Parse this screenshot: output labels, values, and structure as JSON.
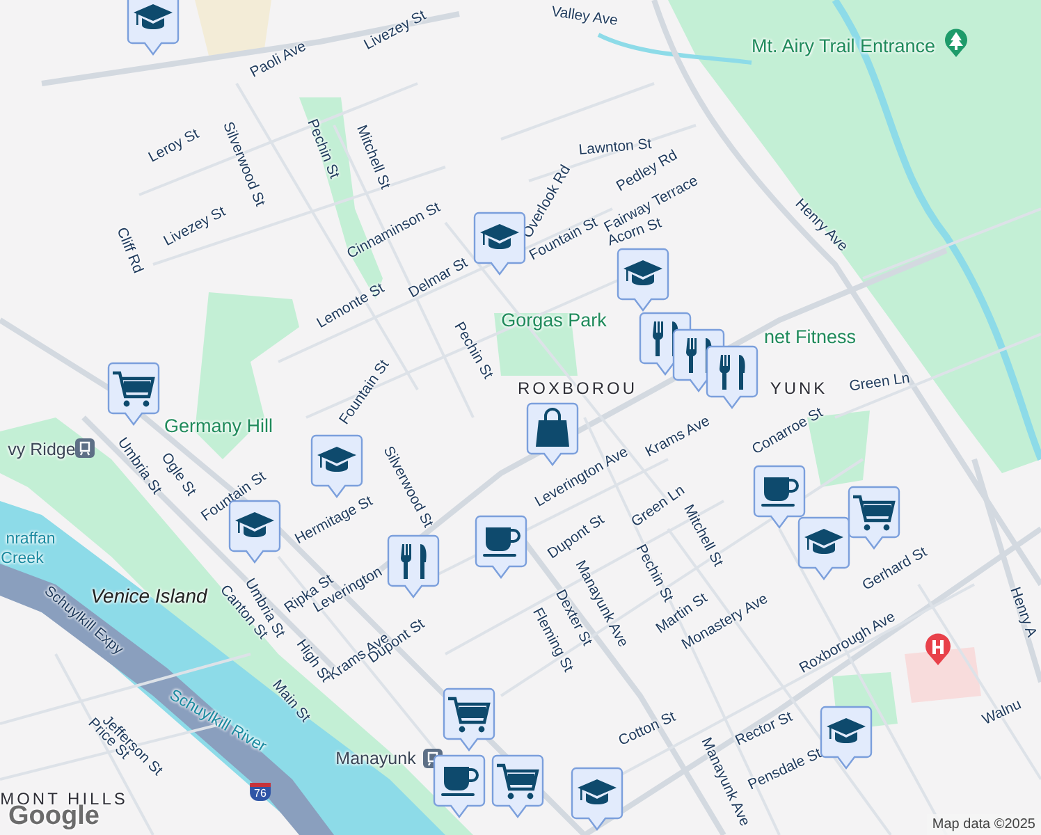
{
  "map": {
    "labels": [
      {
        "text": "Valley Ave",
        "kind": "street"
      },
      {
        "text": "Mt. Airy Trail Entrance",
        "kind": "park"
      },
      {
        "text": "Paoli Ave",
        "kind": "street"
      },
      {
        "text": "Livezey St",
        "kind": "street"
      },
      {
        "text": "Leroy St",
        "kind": "street"
      },
      {
        "text": "Silverwood St",
        "kind": "street"
      },
      {
        "text": "Pechin St",
        "kind": "street"
      },
      {
        "text": "Mitchell St",
        "kind": "street"
      },
      {
        "text": "Livezey St",
        "kind": "street"
      },
      {
        "text": "Cliff Rd",
        "kind": "street"
      },
      {
        "text": "Cinnaminson St",
        "kind": "street"
      },
      {
        "text": "Lemonte St",
        "kind": "street"
      },
      {
        "text": "Delmar St",
        "kind": "street"
      },
      {
        "text": "Pechin St",
        "kind": "street"
      },
      {
        "text": "Fountain St",
        "kind": "street"
      },
      {
        "text": "Overlook Rd",
        "kind": "street"
      },
      {
        "text": "Fountain St",
        "kind": "street"
      },
      {
        "text": "Lawnton St",
        "kind": "street"
      },
      {
        "text": "Pedley Rd",
        "kind": "street"
      },
      {
        "text": "Fairway Terrace",
        "kind": "street"
      },
      {
        "text": "Acorn St",
        "kind": "street"
      },
      {
        "text": "Henry Ave",
        "kind": "street"
      },
      {
        "text": "Gorgas Park",
        "kind": "park"
      },
      {
        "text": "net Fitness",
        "kind": "park"
      },
      {
        "text": "Germany Hill",
        "kind": "park"
      },
      {
        "text": "vy Ridge",
        "kind": "station"
      },
      {
        "text": "ROXBOROU",
        "kind": "area"
      },
      {
        "text": "YUNK",
        "kind": "area"
      },
      {
        "text": "Green Ln",
        "kind": "street"
      },
      {
        "text": "Leverington Ave",
        "kind": "street"
      },
      {
        "text": "Krams Ave",
        "kind": "street"
      },
      {
        "text": "Conarroe St",
        "kind": "street"
      },
      {
        "text": "Ogle St",
        "kind": "street"
      },
      {
        "text": "Umbria St",
        "kind": "street"
      },
      {
        "text": "Fountain St",
        "kind": "street"
      },
      {
        "text": "Hermitage St",
        "kind": "street"
      },
      {
        "text": "Silverwood St",
        "kind": "street"
      },
      {
        "text": "Ripka St",
        "kind": "street"
      },
      {
        "text": "Leverington",
        "kind": "street"
      },
      {
        "text": "Umbria St",
        "kind": "street"
      },
      {
        "text": "Canton St",
        "kind": "street"
      },
      {
        "text": "Krams Ave",
        "kind": "street"
      },
      {
        "text": "Dupont St",
        "kind": "street"
      },
      {
        "text": "High St",
        "kind": "street"
      },
      {
        "text": "Main St",
        "kind": "street"
      },
      {
        "text": "Venice Island",
        "kind": "island"
      },
      {
        "text": "Schuylkill Expy",
        "kind": "street"
      },
      {
        "text": "Schuylkill River",
        "kind": "water"
      },
      {
        "text": "Jefferson St",
        "kind": "street"
      },
      {
        "text": "Price St",
        "kind": "street"
      },
      {
        "text": "Manayunk",
        "kind": "station"
      },
      {
        "text": "Dupont St",
        "kind": "street"
      },
      {
        "text": "Green Ln",
        "kind": "street"
      },
      {
        "text": "Pechin St",
        "kind": "street"
      },
      {
        "text": "Mitchell St",
        "kind": "street"
      },
      {
        "text": "Manayunk Ave",
        "kind": "street"
      },
      {
        "text": "Dexter St",
        "kind": "street"
      },
      {
        "text": "Fleming St",
        "kind": "street"
      },
      {
        "text": "Martin St",
        "kind": "street"
      },
      {
        "text": "Monastery Ave",
        "kind": "street"
      },
      {
        "text": "Roxborough Ave",
        "kind": "street"
      },
      {
        "text": "Gerhard St",
        "kind": "street"
      },
      {
        "text": "Cotton St",
        "kind": "street"
      },
      {
        "text": "Rector St",
        "kind": "street"
      },
      {
        "text": "Pensdale St",
        "kind": "street"
      },
      {
        "text": "Manayunk Ave",
        "kind": "street"
      },
      {
        "text": "Henry A",
        "kind": "street"
      },
      {
        "text": "Walnu",
        "kind": "street"
      },
      {
        "text": "nraffan",
        "kind": "water"
      },
      {
        "text": "Creek",
        "kind": "water"
      },
      {
        "text": "MONT HILLS",
        "kind": "area"
      },
      {
        "text": "76",
        "kind": "shield"
      }
    ],
    "pins": [
      {
        "kind": "school"
      },
      {
        "kind": "school"
      },
      {
        "kind": "school"
      },
      {
        "kind": "school"
      },
      {
        "kind": "school"
      },
      {
        "kind": "school"
      },
      {
        "kind": "school"
      },
      {
        "kind": "school"
      },
      {
        "kind": "cart"
      },
      {
        "kind": "cart"
      },
      {
        "kind": "cart"
      },
      {
        "kind": "cart"
      },
      {
        "kind": "food"
      },
      {
        "kind": "food"
      },
      {
        "kind": "food"
      },
      {
        "kind": "food"
      },
      {
        "kind": "cup"
      },
      {
        "kind": "cup"
      },
      {
        "kind": "cup"
      },
      {
        "kind": "bag"
      }
    ],
    "logo": "Google",
    "attribution": "Map data ©2025"
  }
}
